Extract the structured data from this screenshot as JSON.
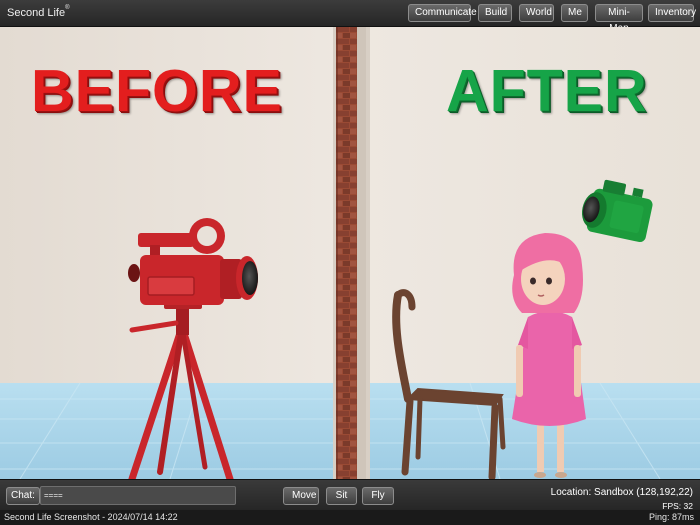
{
  "app": {
    "title": "Second Life",
    "trademark": "®"
  },
  "menu": {
    "items": [
      {
        "label": "Communicate"
      },
      {
        "label": "Build"
      },
      {
        "label": "World"
      },
      {
        "label": "Me"
      },
      {
        "label": "Mini-Map"
      },
      {
        "label": "Inventory"
      }
    ]
  },
  "scene": {
    "left_word": "BEFORE",
    "right_word": "AFTER",
    "colors": {
      "before_text": "#e31e1e",
      "after_text": "#16a448",
      "wall": "#e8e1d9",
      "floor": "#a6d2e8",
      "brick": "#8a3f2b",
      "camera_left": "#c9262b",
      "camera_right": "#1c9b3c",
      "girl_hair": "#ef6ea3",
      "dress": "#ea64aa",
      "chair": "#6b4330"
    }
  },
  "hud": {
    "chat_label": "Chat:",
    "chat_value": "====",
    "buttons": [
      {
        "label": "Move"
      },
      {
        "label": "Sit"
      },
      {
        "label": "Fly"
      }
    ],
    "location": "Location: Sandbox (128,192,22)",
    "fps": "FPS: 32"
  },
  "status": {
    "left": "Second Life Screenshot - 2024/07/14 14:22",
    "right": "Ping: 87ms"
  }
}
